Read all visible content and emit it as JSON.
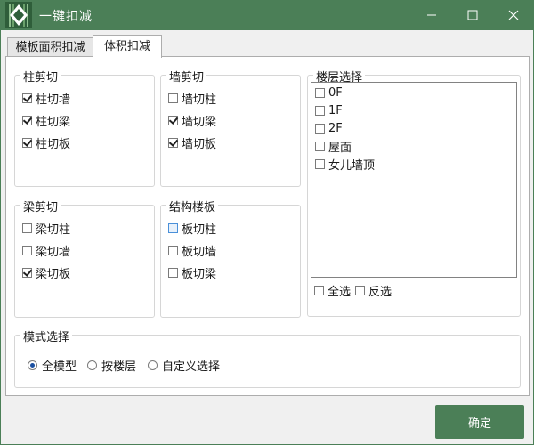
{
  "window": {
    "title": "一键扣减",
    "ok_label": "确定"
  },
  "tabs": [
    {
      "label": "模板面积扣减",
      "active": false
    },
    {
      "label": "体积扣减",
      "active": true
    }
  ],
  "groups": {
    "column_cut": {
      "title": "柱剪切",
      "items": [
        {
          "label": "柱切墙",
          "checked": true
        },
        {
          "label": "柱切梁",
          "checked": true
        },
        {
          "label": "柱切板",
          "checked": true
        }
      ]
    },
    "wall_cut": {
      "title": "墙剪切",
      "items": [
        {
          "label": "墙切柱",
          "checked": false
        },
        {
          "label": "墙切梁",
          "checked": true
        },
        {
          "label": "墙切板",
          "checked": true
        }
      ]
    },
    "beam_cut": {
      "title": "梁剪切",
      "items": [
        {
          "label": "梁切柱",
          "checked": false
        },
        {
          "label": "梁切墙",
          "checked": false
        },
        {
          "label": "梁切板",
          "checked": true
        }
      ]
    },
    "slab": {
      "title": "结构楼板",
      "items": [
        {
          "label": "板切柱",
          "checked": false
        },
        {
          "label": "板切墙",
          "checked": false
        },
        {
          "label": "板切梁",
          "checked": false
        }
      ]
    },
    "floors": {
      "title": "楼层选择",
      "items": [
        {
          "label": "0F",
          "checked": false
        },
        {
          "label": "1F",
          "checked": false
        },
        {
          "label": "2F",
          "checked": false
        },
        {
          "label": "屋面",
          "checked": false
        },
        {
          "label": "女儿墙顶",
          "checked": false
        }
      ],
      "select_all": "全选",
      "invert": "反选"
    },
    "mode": {
      "title": "模式选择",
      "options": [
        {
          "label": "全模型",
          "selected": true
        },
        {
          "label": "按楼层",
          "selected": false
        },
        {
          "label": "自定义选择",
          "selected": false
        }
      ]
    }
  }
}
